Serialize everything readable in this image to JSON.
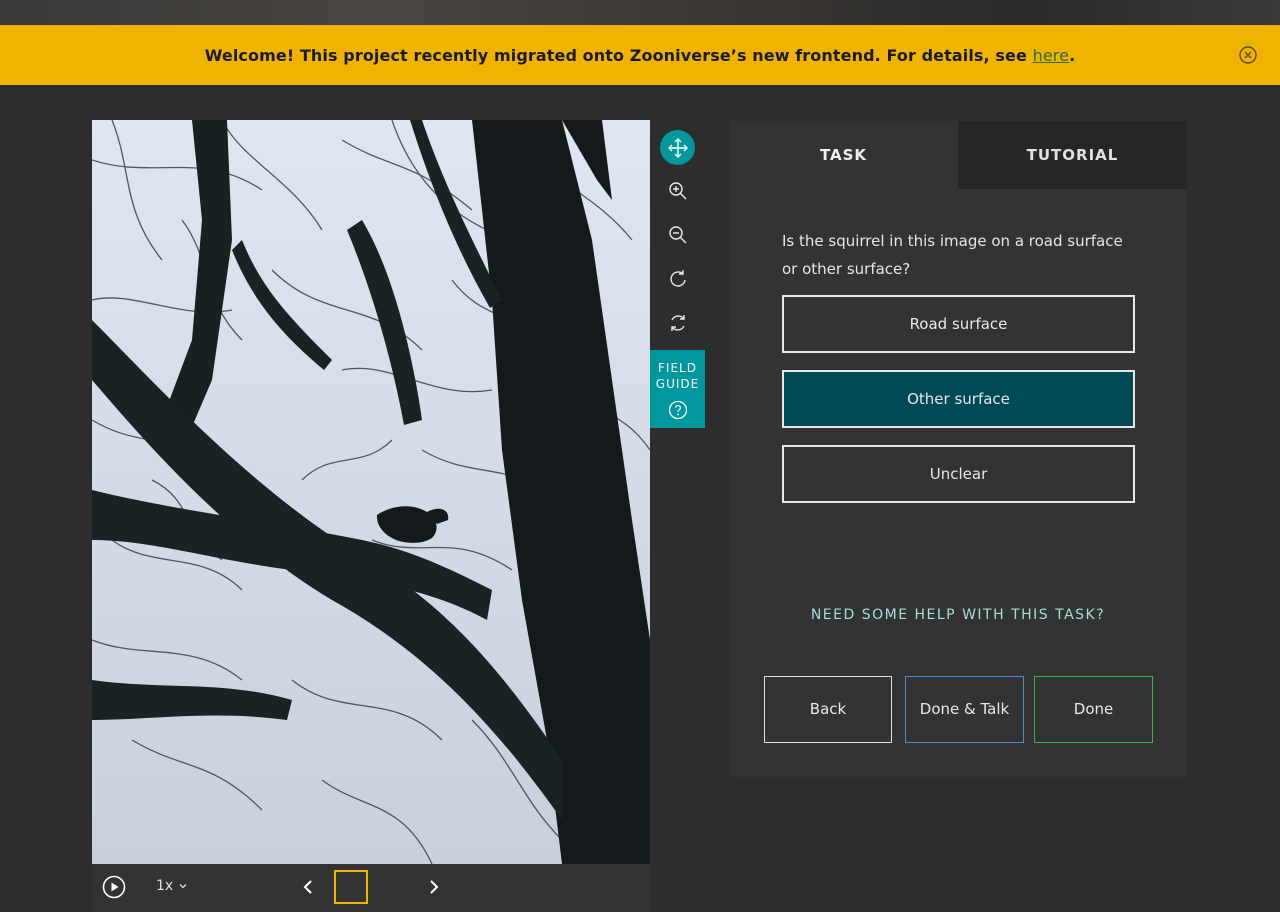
{
  "banner": {
    "text": "Welcome! This project recently migrated onto Zooniverse’s new frontend. For details, see ",
    "link_label": "here",
    "suffix": "."
  },
  "toolbar": {
    "tools": [
      "move-icon",
      "zoom-in-icon",
      "zoom-out-icon",
      "rotate-icon",
      "reset-icon"
    ],
    "active_tool": "move-icon",
    "field_guide_line1": "FIELD",
    "field_guide_line2": "GUIDE"
  },
  "controls": {
    "speed_label": "1x"
  },
  "task": {
    "tabs": [
      {
        "label": "TASK",
        "active": true
      },
      {
        "label": "TUTORIAL",
        "active": false
      }
    ],
    "question": "Is the squirrel in this image on a road surface or other surface?",
    "answers": [
      {
        "label": "Road surface",
        "selected": false
      },
      {
        "label": "Other surface",
        "selected": true
      },
      {
        "label": "Unclear",
        "selected": false
      }
    ],
    "help_label": "NEED SOME HELP WITH THIS TASK?",
    "back_label": "Back",
    "done_talk_label": "Done & Talk",
    "done_label": "Done"
  },
  "colors": {
    "banner": "#f0b400",
    "accent": "#00979d",
    "selected_answer": "#004a57",
    "done_talk_border": "#4a8fd6",
    "done_border": "#3cb34a"
  }
}
